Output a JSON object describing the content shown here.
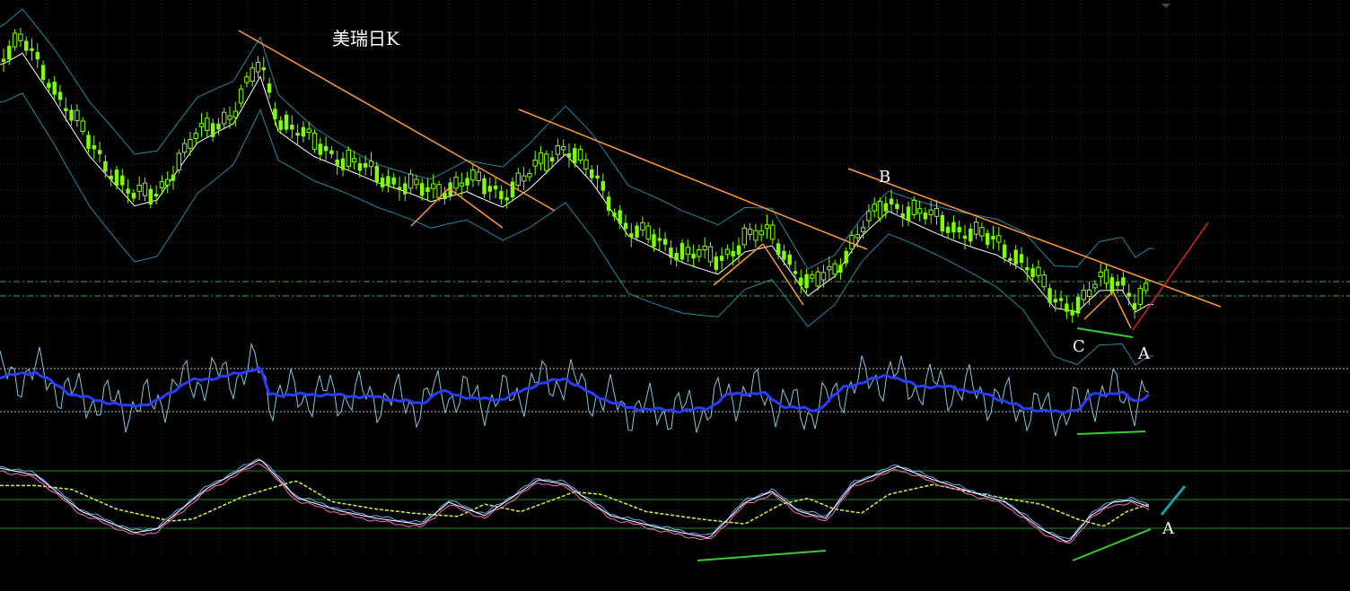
{
  "chart_data": [
    {
      "type": "candlestick",
      "title": "美瑞日K",
      "panel": "price",
      "grid": true,
      "colors": {
        "up": "#7fff00",
        "down": "#ffffff",
        "ma": "#ffffff",
        "bands": "#1f8aa0",
        "trendlines": "#ff9933",
        "breakout": "#e02020",
        "support": "#33cc33"
      },
      "annotations": [
        {
          "text": "B"
        },
        {
          "text": "C"
        },
        {
          "text": "A"
        }
      ],
      "horizontal_levels": 2
    },
    {
      "type": "line",
      "panel": "indicator-1",
      "series_colors": [
        "#2a3cff",
        "#7ec8e0"
      ],
      "reference_lines": 2
    },
    {
      "type": "line",
      "panel": "indicator-2",
      "series_colors": [
        "#ffffff",
        "#ff66cc",
        "#66aaff",
        "#ccff33"
      ],
      "reference_lines": 3,
      "annotations": [
        {
          "text": "A"
        }
      ]
    }
  ]
}
